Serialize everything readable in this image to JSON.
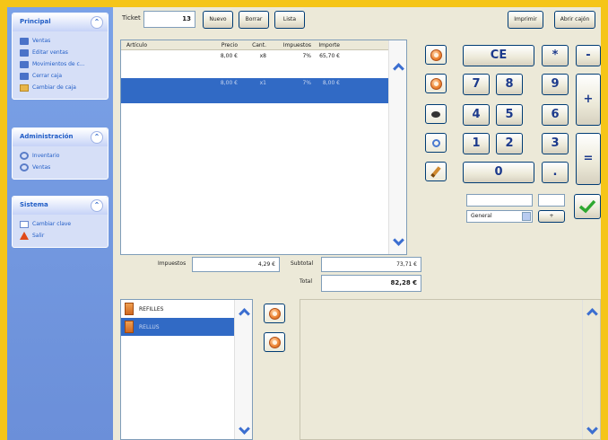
{
  "sidebar": {
    "panels": [
      {
        "title": "Principal",
        "items": [
          "Ventas",
          "Editar ventas",
          "Movimientos de c...",
          "Cerrar caja",
          "Cambiar de caja"
        ]
      },
      {
        "title": "Administración",
        "items": [
          "Inventario",
          "Ventas"
        ]
      },
      {
        "title": "Sistema",
        "items": [
          "Cambiar clave",
          "Salir"
        ]
      }
    ]
  },
  "toolbar": {
    "ticket_label": "Ticket",
    "ticket_number": "13",
    "new_label": "Nuevo",
    "delete_label": "Borrar",
    "list_label": "Lista",
    "print_label": "Imprimir",
    "open_drawer_label": "Abrir cajón"
  },
  "ticket": {
    "columns": [
      "Artículo",
      "Precio",
      "Cant.",
      "Impuestos",
      "Importe"
    ],
    "rows": [
      {
        "item": "",
        "price": "8,00 €",
        "qty": "x8",
        "tax": "7%",
        "amount": "65,70 €",
        "selected": false
      },
      {
        "item": "",
        "price": "8,00 €",
        "qty": "x1",
        "tax": "7%",
        "amount": "8,00 €",
        "selected": true
      }
    ]
  },
  "keypad": {
    "ce": "CE",
    "digits": [
      "7",
      "8",
      "9",
      "4",
      "5",
      "6",
      "1",
      "2",
      "3",
      "0"
    ],
    "multiply": "*",
    "minus": "-",
    "plus": "+",
    "equals": "=",
    "decimal": "."
  },
  "payment": {
    "method": "General",
    "add_label": "+"
  },
  "totals": {
    "tax_label": "Impuestos",
    "tax_value": "4,29 €",
    "subtotal_label": "Subtotal",
    "subtotal_value": "73,71 €",
    "total_label": "Total",
    "total_value": "82,28 €"
  },
  "catalog": {
    "categories": [
      {
        "name": "REFILLES",
        "selected": false
      },
      {
        "name": "RELLUS",
        "selected": true
      }
    ]
  },
  "colors": {
    "background": "#f5c518",
    "sidebar": "#6b8fd9",
    "selection": "#316ac5",
    "accent_orange": "#f08a3a",
    "keypad_text": "#1c3a8c"
  }
}
